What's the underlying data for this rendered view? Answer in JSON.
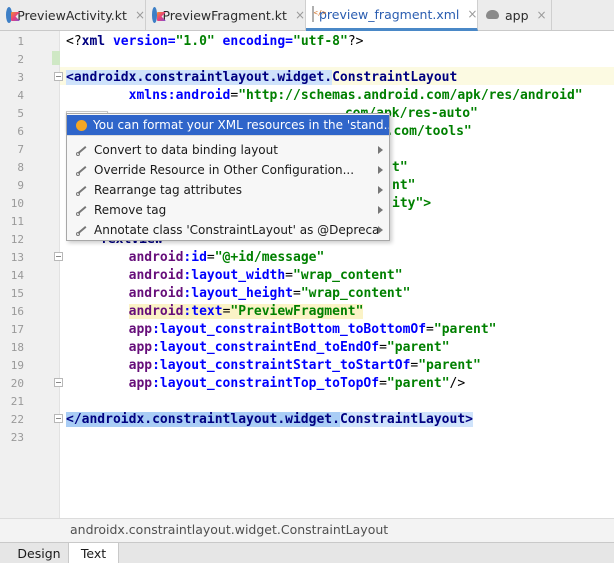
{
  "tabs": [
    {
      "label": "PreviewActivity.kt",
      "icon": "kotlin-file-icon",
      "active": false
    },
    {
      "label": "PreviewFragment.kt",
      "icon": "kotlin-file-icon",
      "active": false
    },
    {
      "label": "preview_fragment.xml",
      "icon": "xml-file-icon",
      "active": true
    },
    {
      "label": "app",
      "icon": "module-icon",
      "active": false
    }
  ],
  "close_glyph": "×",
  "line_numbers": [
    "1",
    "2",
    "3",
    "4",
    "5",
    "6",
    "7",
    "8",
    "9",
    "10",
    "11",
    "12",
    "13",
    "14",
    "15",
    "16",
    "17",
    "18",
    "19",
    "20",
    "21",
    "22",
    "23"
  ],
  "code": {
    "l1": {
      "decl_open": "<?",
      "decl_name": "xml",
      "a1": " version=",
      "v1": "\"1.0\"",
      "a2": " encoding=",
      "v2": "\"utf-8\"",
      "decl_close": "?>"
    },
    "l3": {
      "open": "<",
      "tag": "androidx.constraintlayout.widget.",
      "tag_last": "ConstraintLayout"
    },
    "l4": {
      "ns": "xmlns:",
      "name": "android",
      "eq": "=",
      "val": "\"http://schemas.android.com/apk/res/android\""
    },
    "l5_tail": ".com/apk/res-auto\"",
    "l6_tail": "id.com/tools\"",
    "l8_tail": "t\"",
    "l9_tail": "nt\"",
    "l10_tail": "ity\">",
    "l12": "TextView",
    "l13": {
      "ns": "android",
      "name": ":id",
      "eq": "=",
      "val": "\"@+id/message\""
    },
    "l14": {
      "ns": "android",
      "name": ":layout_width",
      "eq": "=",
      "val": "\"wrap_content\""
    },
    "l15": {
      "ns": "android",
      "name": ":layout_height",
      "eq": "=",
      "val": "\"wrap_content\""
    },
    "l16": {
      "ns": "android",
      "name": ":text",
      "eq": "=",
      "val": "\"PreviewFragment\""
    },
    "l17": {
      "ns": "app",
      "name": ":layout_constraintBottom_toBottomOf",
      "eq": "=",
      "val": "\"parent\""
    },
    "l18": {
      "ns": "app",
      "name": ":layout_constraintEnd_toEndOf",
      "eq": "=",
      "val": "\"parent\""
    },
    "l19": {
      "ns": "app",
      "name": ":layout_constraintStart_toStartOf",
      "eq": "=",
      "val": "\"parent\""
    },
    "l20": {
      "ns": "app",
      "name": ":layout_constraintTop_toTopOf",
      "eq": "=",
      "val": "\"parent\"",
      "close": "/>"
    },
    "l22": {
      "open": "</",
      "tag": "androidx.constraintlayout.widget.",
      "tag_last": "ConstraintLayout",
      "close": ">"
    }
  },
  "intention_menu": [
    {
      "label": "You can format your XML resources in the 'stand...",
      "icon": "bulb-icon",
      "submenu": false,
      "selected": true
    },
    {
      "label": "Convert to data binding layout",
      "icon": "wrench-icon",
      "submenu": true,
      "selected": false
    },
    {
      "label": "Override Resource in Other Configuration...",
      "icon": "wrench-icon",
      "submenu": true,
      "selected": false
    },
    {
      "label": "Rearrange tag attributes",
      "icon": "wrench-icon",
      "submenu": true,
      "selected": false
    },
    {
      "label": "Remove tag",
      "icon": "wrench-icon",
      "submenu": true,
      "selected": false
    },
    {
      "label": "Annotate class 'ConstraintLayout' as @Deprecated",
      "icon": "wrench-icon",
      "submenu": true,
      "selected": false
    }
  ],
  "breadcrumb": "androidx.constraintlayout.widget.ConstraintLayout",
  "bottom_tabs": [
    {
      "label": "Design",
      "active": false
    },
    {
      "label": "Text",
      "active": true
    }
  ],
  "colors": {
    "accent": "#4a88c7",
    "menu_selection": "#2f65ca",
    "tag": "#000080",
    "attribute": "#0000ff",
    "namespace": "#660e7a",
    "string_value": "#008000"
  }
}
